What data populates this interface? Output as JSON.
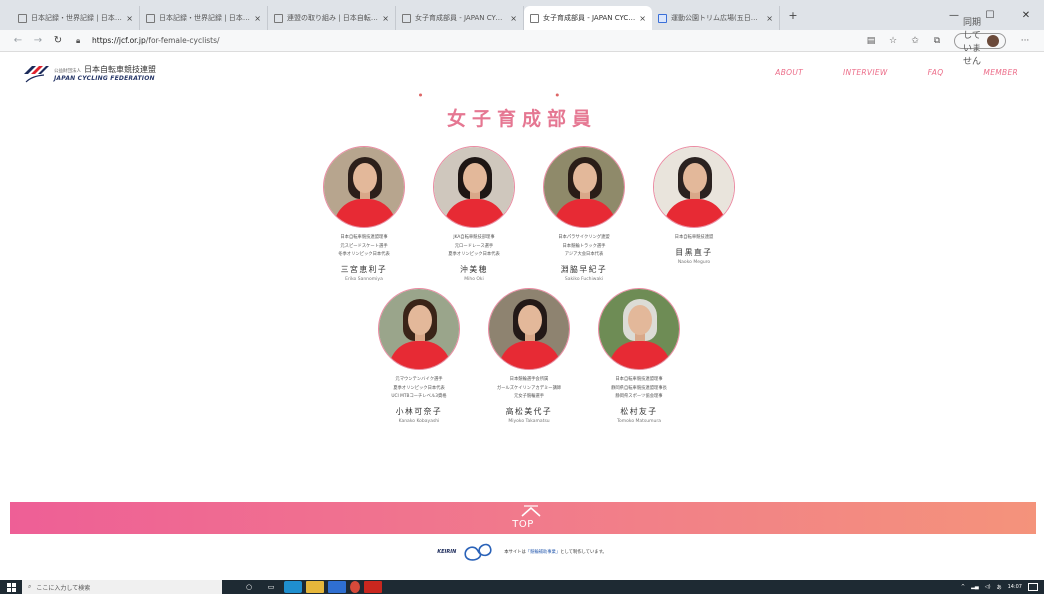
{
  "browser": {
    "tabs": [
      {
        "title": "日本記録・世界記録 | 日本自転車競",
        "active": false
      },
      {
        "title": "日本記録・世界記録 | 日本自転車競",
        "active": false
      },
      {
        "title": "連盟の取り組み | 日本自転車競技連",
        "active": false
      },
      {
        "title": "女子育成部員 - JAPAN CYCLING",
        "active": false
      },
      {
        "title": "女子育成部員 - JAPAN CYCLING",
        "active": true
      },
      {
        "title": "運動公園トリム広場(五日市)JKA",
        "active": false
      }
    ],
    "url_host": "https://jcf.or.jp",
    "url_path": "/for-female-cyclists/",
    "sync_label": "同期していません"
  },
  "site": {
    "logo_jp_small": "公益財団法人",
    "logo_jp": "日本自転車競技連盟",
    "logo_en": "JAPAN CYCLING FEDERATION",
    "nav": [
      "ABOUT",
      "INTERVIEW",
      "FAQ",
      "MEMBER"
    ],
    "page_title": "女子育成部員"
  },
  "members": [
    {
      "affiliation": [
        "日本自転車競技連盟理事",
        "元スピードスケート選手",
        "冬季オリンピック日本代表"
      ],
      "name": "三宮恵利子",
      "roman": "Eriko Sannomiya",
      "bg": "#b7a58e",
      "hair": "#2c1f1a"
    },
    {
      "affiliation": [
        "JKA自転車競技部理事",
        "元ロードレース選手",
        "夏季オリンピック日本代表"
      ],
      "name": "沖美穂",
      "roman": "Miho Oki",
      "bg": "#cfc7bd",
      "hair": "#1e1614"
    },
    {
      "affiliation": [
        "日本パラサイクリング連盟",
        "日本競輪トラック選手",
        "アジア大会日本代表"
      ],
      "name": "淵脇早紀子",
      "roman": "Sakiko Fuchiwaki",
      "bg": "#8f8a6a",
      "hair": "#2a1d17"
    },
    {
      "affiliation": [
        "日本自転車競技連盟"
      ],
      "name": "目黒直子",
      "roman": "Naoko Meguro",
      "bg": "#e9e4dc",
      "hair": "#2b2220"
    },
    {
      "affiliation": [
        "元マウンテンバイク選手",
        "夏季オリンピック日本代表",
        "UCI MTBコーチレベル3資格"
      ],
      "name": "小林可奈子",
      "roman": "Kanako Kobayashi",
      "bg": "#9aa58b",
      "hair": "#3a2418"
    },
    {
      "affiliation": [
        "日本競輪選手会所属",
        "ガールズケイリンアカデミー講師",
        "元女子競輪選手"
      ],
      "name": "高松美代子",
      "roman": "Miyoko Takamatsu",
      "bg": "#8e8370",
      "hair": "#231917"
    },
    {
      "affiliation": [
        "日本自転車競技連盟理事",
        "静岡県自転車競技連盟理事長",
        "静岡県スポーツ協会理事"
      ],
      "name": "松村友子",
      "roman": "Tomoko Matsumura",
      "bg": "#6e8c55",
      "hair": "#dcdcd6"
    }
  ],
  "footer": {
    "top_label": "TOP",
    "keirin": "KEIRIN",
    "note_prefix": "本サイトは",
    "note_link": "「競輪補助事業」",
    "note_suffix": "として制作しています。"
  },
  "taskbar": {
    "search_placeholder": "ここに入力して検索",
    "time": "14:07"
  }
}
